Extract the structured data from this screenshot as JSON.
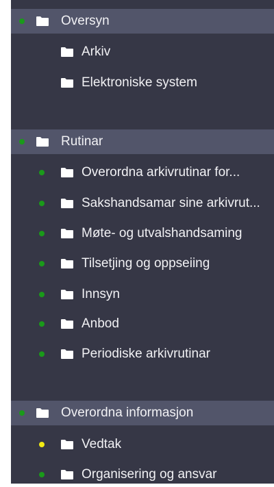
{
  "colors": {
    "panel_bg": "#363746",
    "section_bg": "#52556a",
    "text": "#f1f1f4",
    "status_green": "#1a9a1a",
    "status_yellow": "#f2ea13"
  },
  "sections": [
    {
      "label": "Oversyn",
      "status": "green",
      "children": [
        {
          "label": "Arkiv",
          "status": "none"
        },
        {
          "label": "Elektroniske system",
          "status": "none"
        }
      ]
    },
    {
      "label": "Rutinar",
      "status": "green",
      "children": [
        {
          "label": "Overordna arkivrutinar for...",
          "status": "green"
        },
        {
          "label": "Sakshandsamar sine arkivrut...",
          "status": "green"
        },
        {
          "label": "Møte- og utvalshandsaming",
          "status": "green"
        },
        {
          "label": "Tilsetjing og oppseiing",
          "status": "green"
        },
        {
          "label": "Innsyn",
          "status": "green"
        },
        {
          "label": "Anbod",
          "status": "green"
        },
        {
          "label": "Periodiske arkivrutinar",
          "status": "green"
        }
      ]
    },
    {
      "label": "Overordna informasjon",
      "status": "green",
      "children": [
        {
          "label": "Vedtak",
          "status": "yellow"
        },
        {
          "label": "Organisering og ansvar",
          "status": "green"
        }
      ]
    }
  ]
}
